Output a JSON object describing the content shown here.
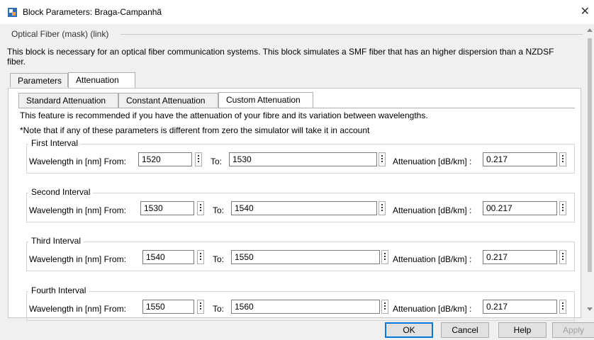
{
  "window": {
    "title": "Block Parameters: Braga-Campanhã",
    "close": "✕"
  },
  "mask": {
    "title": "Optical Fiber (mask) (link)",
    "description": "This block is necessary for an  optical fiber communication systems. This block simulates a SMF fiber that has an higher dispersion than a NZDSF fiber."
  },
  "tabs": [
    {
      "label": "Parameters"
    },
    {
      "label": "Attenuation"
    }
  ],
  "subtabs": [
    {
      "label": "Standard Attenuation"
    },
    {
      "label": "Constant Attenuation"
    },
    {
      "label": "Custom Attenuation"
    }
  ],
  "custom": {
    "info1": "This feature is recommended if you have the attenuation of your fibre and its variation between wavelengths.",
    "info2": "*Note that if any of these parameters is different from zero the simulator will take it in account",
    "labels": {
      "from": "Wavelength in [nm] From:",
      "to": "To:",
      "att": "Attenuation [dB/km] :"
    },
    "intervals": [
      {
        "title": "First Interval",
        "from": "1520",
        "to": "1530",
        "att": "0.217"
      },
      {
        "title": "Second Interval",
        "from": "1530",
        "to": "1540",
        "att": "00.217"
      },
      {
        "title": "Third Interval",
        "from": "1540",
        "to": "1550",
        "att": "0.217"
      },
      {
        "title": "Fourth Interval",
        "from": "1550",
        "to": "1560",
        "att": "0.217"
      }
    ]
  },
  "buttons": {
    "ok": "OK",
    "cancel": "Cancel",
    "help": "Help",
    "apply": "Apply"
  },
  "colors": {
    "accent": "#0078d7"
  }
}
